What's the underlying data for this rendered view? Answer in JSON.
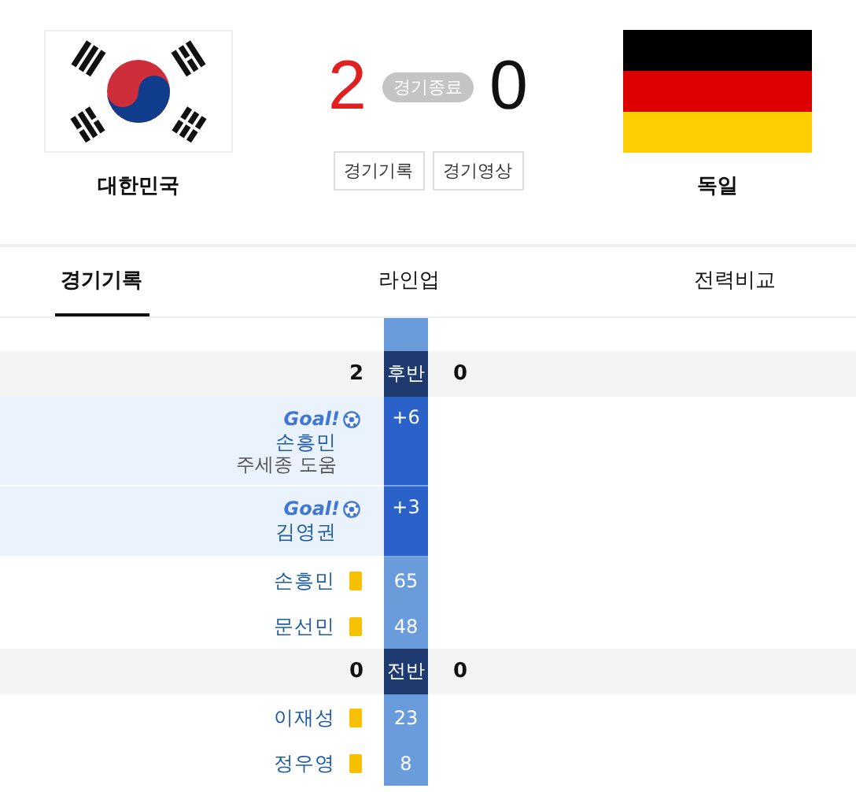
{
  "match": {
    "home": {
      "name": "대한민국",
      "score": "2"
    },
    "away": {
      "name": "독일",
      "score": "0"
    },
    "status": "경기종료",
    "buttons": [
      "경기기록",
      "경기영상"
    ]
  },
  "tabs": [
    {
      "label": "경기기록",
      "selected": true
    },
    {
      "label": "라인업",
      "selected": false
    },
    {
      "label": "전력비교",
      "selected": false
    }
  ],
  "timeline": [
    {
      "kind": "half",
      "label": "후반",
      "home_score": "2",
      "away_score": "0"
    },
    {
      "kind": "goal",
      "goal_label": "Goal!",
      "player": "손흥민",
      "assist": "주세종 도움",
      "minute": "+6"
    },
    {
      "kind": "goal",
      "goal_label": "Goal!",
      "player": "김영권",
      "minute": "+3"
    },
    {
      "kind": "card",
      "player": "손흥민",
      "minute": "65"
    },
    {
      "kind": "card",
      "player": "문선민",
      "minute": "48"
    },
    {
      "kind": "half",
      "label": "전반",
      "home_score": "0",
      "away_score": "0"
    },
    {
      "kind": "card",
      "player": "이재성",
      "minute": "23"
    },
    {
      "kind": "card",
      "player": "정우영",
      "minute": "8"
    }
  ]
}
